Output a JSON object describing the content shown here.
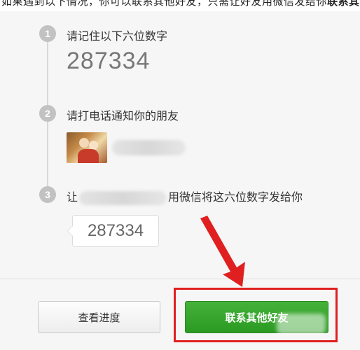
{
  "header": {
    "fragment_text": "如果遇到以下情况，你可以联系其他好友，只需让好友用微信发给你",
    "fragment_bold": "联系其"
  },
  "steps": [
    {
      "number": "1",
      "title": "请记住以下六位数字",
      "code": "287334"
    },
    {
      "number": "2",
      "title": "请打电话通知你的朋友",
      "friend_name": ""
    },
    {
      "number": "3",
      "title_prefix": "让",
      "title_suffix": "用微信将这六位数字发给你",
      "code": "287334"
    }
  ],
  "buttons": {
    "progress_label": "查看进度",
    "contact_label": "联系其他好友"
  },
  "colors": {
    "accent_green": "#2f9e27",
    "highlight_red": "#e02020",
    "step_circle": "#c2c2c2"
  },
  "icons": {
    "avatar": "friend-avatar-photo",
    "arrow": "red-pointer-arrow"
  }
}
